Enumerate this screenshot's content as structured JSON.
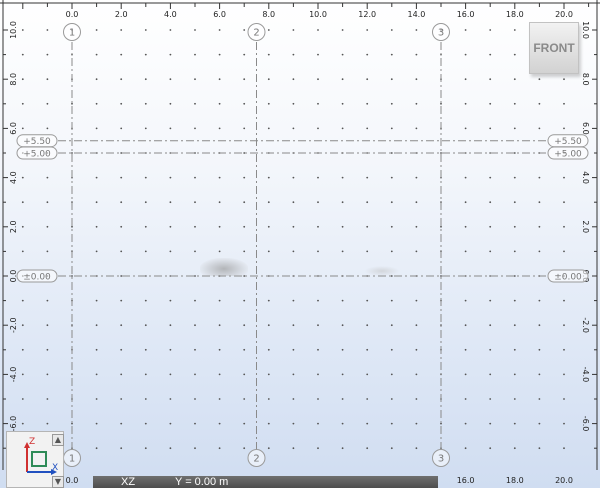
{
  "view_cube": {
    "label": "FRONT"
  },
  "ruler_top": {
    "ticks": [
      "0.0",
      "2.0",
      "4.0",
      "6.0",
      "8.0",
      "10.0",
      "12.0",
      "14.0",
      "16.0",
      "18.0",
      "20.0"
    ]
  },
  "ruler_bottom": {
    "ticks": [
      "0.0",
      "16.0",
      "18.0",
      "20.0"
    ]
  },
  "ruler_left": {
    "ticks": [
      "10.0",
      "8.0",
      "6.0",
      "4.0",
      "2.0",
      "0.0",
      "-2.0",
      "-4.0",
      "-6.0"
    ]
  },
  "ruler_right": {
    "ticks": [
      "10.0",
      "8.0",
      "6.0",
      "4.0",
      "2.0",
      "0.0",
      "-2.0",
      "-4.0",
      "-6.0"
    ]
  },
  "grid_axes": [
    {
      "label": "1"
    },
    {
      "label": "2"
    },
    {
      "label": "3"
    }
  ],
  "levels": [
    {
      "label": "+5.50"
    },
    {
      "label": "+5.00"
    },
    {
      "label": "±0.00"
    }
  ],
  "status": {
    "plane": "XZ",
    "coordinate": "Y = 0.00 m"
  },
  "nav_widget": {
    "axis_z": "Z",
    "axis_x": "X"
  }
}
